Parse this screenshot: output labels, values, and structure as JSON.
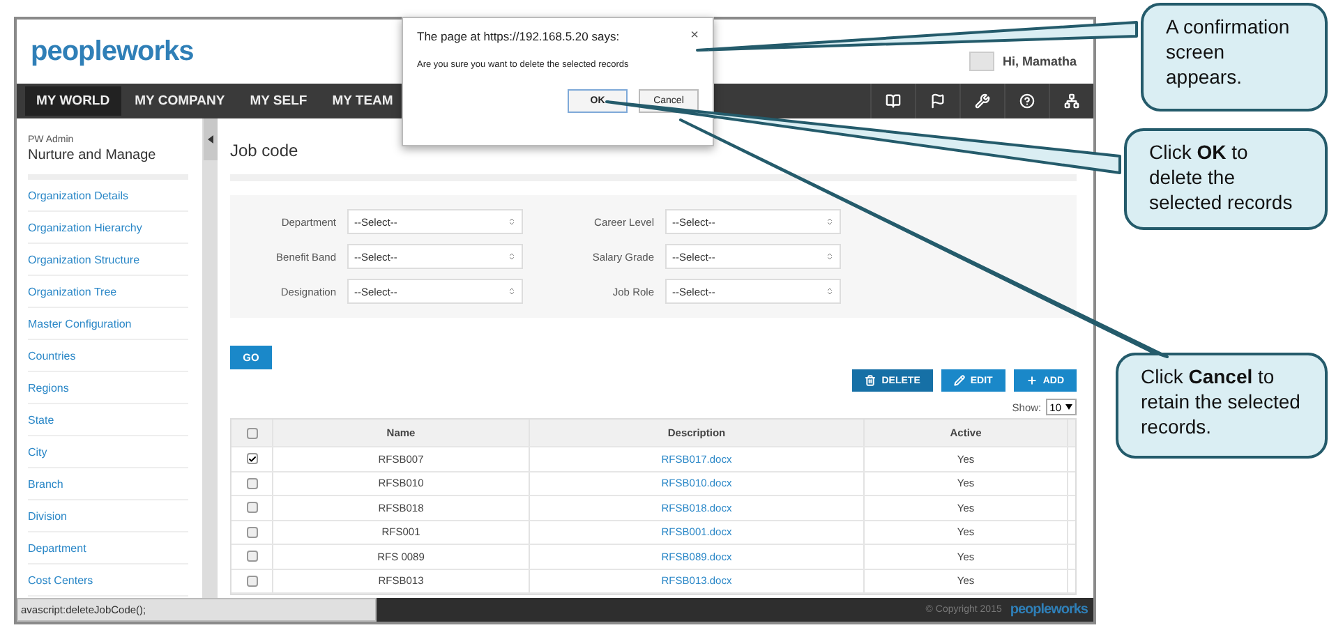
{
  "header": {
    "logo": "peopleworks",
    "greeting": "Hi, Mamatha"
  },
  "nav": {
    "items": [
      {
        "label": "MY WORLD",
        "selected": true
      },
      {
        "label": "MY COMPANY",
        "selected": false
      },
      {
        "label": "MY SELF",
        "selected": false
      },
      {
        "label": "MY TEAM",
        "selected": false
      }
    ]
  },
  "dialog": {
    "title": "The page at https://192.168.5.20 says:",
    "close": "×",
    "message": "Are you sure you want to delete the selected records",
    "buttons": [
      {
        "label": "OK",
        "selected": true
      },
      {
        "label": "Cancel",
        "selected": false
      }
    ]
  },
  "sidebar": {
    "role": "PW Admin",
    "title": "Nurture and Manage",
    "items": [
      "Organization Details",
      "Organization Hierarchy",
      "Organization Structure",
      "Organization Tree",
      "Master Configuration",
      "Countries",
      "Regions",
      "State",
      "City",
      "Branch",
      "Division",
      "Department",
      "Cost Centers"
    ]
  },
  "page": {
    "title": "Job code"
  },
  "filters": [
    {
      "label": "Department",
      "value": "--Select--"
    },
    {
      "label": "Career Level",
      "value": "--Select--"
    },
    {
      "label": "Benefit Band",
      "value": "--Select--"
    },
    {
      "label": "Salary Grade",
      "value": "--Select--"
    },
    {
      "label": "Designation",
      "value": "--Select--"
    },
    {
      "label": "Job Role",
      "value": "--Select--"
    }
  ],
  "go_button": "GO",
  "actions": [
    {
      "kind": "delete",
      "label": "DELETE"
    },
    {
      "kind": "edit",
      "label": "EDIT"
    },
    {
      "kind": "add",
      "label": "ADD"
    }
  ],
  "show": {
    "label": "Show:",
    "value": "10"
  },
  "table": {
    "select_all": false,
    "columns": [
      "Name",
      "Description",
      "Active"
    ],
    "rows": [
      {
        "checked": true,
        "name": "RFSB007",
        "description": "RFSB017.docx",
        "active": "Yes"
      },
      {
        "checked": false,
        "name": "RFSB010",
        "description": "RFSB010.docx",
        "active": "Yes"
      },
      {
        "checked": false,
        "name": "RFSB018",
        "description": "RFSB018.docx",
        "active": "Yes"
      },
      {
        "checked": false,
        "name": "RFS001",
        "description": "RFSB001.docx",
        "active": "Yes"
      },
      {
        "checked": false,
        "name": "RFS 0089",
        "description": "RFSB089.docx",
        "active": "Yes"
      },
      {
        "checked": false,
        "name": "RFSB013",
        "description": "RFSB013.docx",
        "active": "Yes"
      }
    ]
  },
  "status_bar": "avascript:deleteJobCode();",
  "footer": {
    "copyright": "© Copyright 2015",
    "logo": "peopleworks"
  },
  "callouts": [
    "A confirmation screen appears.",
    "Click **OK** to delete the selected records",
    "Click **Cancel** to retain the selected records."
  ]
}
